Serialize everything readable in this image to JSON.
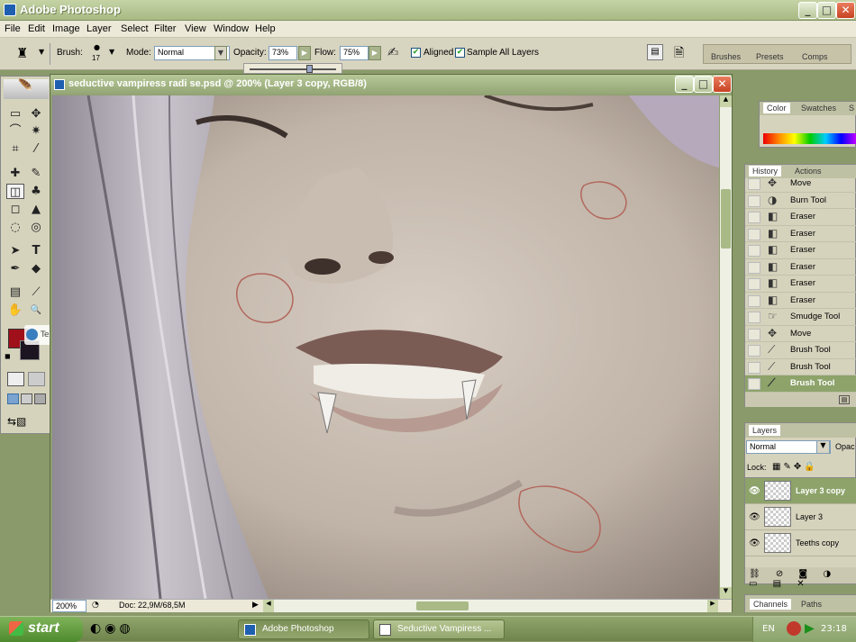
{
  "app": {
    "title": "Adobe Photoshop",
    "controls": {
      "minimize": "_",
      "restore": "□",
      "close": "✕"
    }
  },
  "menu": [
    "File",
    "Edit",
    "Image",
    "Layer",
    "Select",
    "Filter",
    "View",
    "Window",
    "Help"
  ],
  "options": {
    "brush_label": "Brush:",
    "brush_size": "17",
    "mode_label": "Mode:",
    "mode_value": "Normal",
    "opacity_label": "Opacity:",
    "opacity_value": "73%",
    "flow_label": "Flow:",
    "flow_value": "75%",
    "aligned_label": "Aligned",
    "sample_label": "Sample All Layers",
    "aligned_checked": true,
    "sample_checked": true
  },
  "palette_well": [
    "Brushes",
    "Presets",
    "Comps"
  ],
  "toolbox": {
    "tools": [
      "▭",
      "✥",
      "⌒",
      "✷",
      "⌗",
      "⁄",
      "✚",
      "✎",
      "◫",
      "♣",
      "◻",
      "▲",
      "◌",
      "◎",
      "➤",
      "T",
      "✒",
      "◆",
      "▤",
      "⟋",
      "✋",
      "🔍"
    ],
    "watermark": "TechTut.com"
  },
  "document": {
    "title": "seductive vampiress radi se.psd @ 200% (Layer 3 copy, RGB/8)",
    "zoom": "200%",
    "doc_info": "Doc: 22,9M/68,5M"
  },
  "color_panel": {
    "tabs": [
      "Color",
      "Swatches",
      "S"
    ]
  },
  "history_panel": {
    "tabs": [
      "History",
      "Actions"
    ],
    "items": [
      {
        "name": "Move",
        "icon": "move-icon"
      },
      {
        "name": "Burn Tool",
        "icon": "burn-icon"
      },
      {
        "name": "Eraser",
        "icon": "eraser-icon"
      },
      {
        "name": "Eraser",
        "icon": "eraser-icon"
      },
      {
        "name": "Eraser",
        "icon": "eraser-icon"
      },
      {
        "name": "Eraser",
        "icon": "eraser-icon"
      },
      {
        "name": "Eraser",
        "icon": "eraser-icon"
      },
      {
        "name": "Eraser",
        "icon": "eraser-icon"
      },
      {
        "name": "Smudge Tool",
        "icon": "smudge-icon"
      },
      {
        "name": "Move",
        "icon": "move-icon"
      },
      {
        "name": "Brush Tool",
        "icon": "brush-icon"
      },
      {
        "name": "Brush Tool",
        "icon": "brush-icon"
      },
      {
        "name": "Brush Tool",
        "icon": "brush-icon"
      }
    ]
  },
  "layers_panel": {
    "tab": "Layers",
    "blend_mode": "Normal",
    "opacity_label": "Opac",
    "lock_label": "Lock:",
    "layers": [
      "Layer 3 copy",
      "Layer 3",
      "Teeths copy"
    ]
  },
  "bottom_panel": {
    "tabs": [
      "Channels",
      "Paths"
    ]
  },
  "taskbar": {
    "start": "start",
    "tasks": [
      "Adobe Photoshop",
      "Seductive Vampiress ..."
    ],
    "lang": "EN",
    "time": "23:18"
  }
}
